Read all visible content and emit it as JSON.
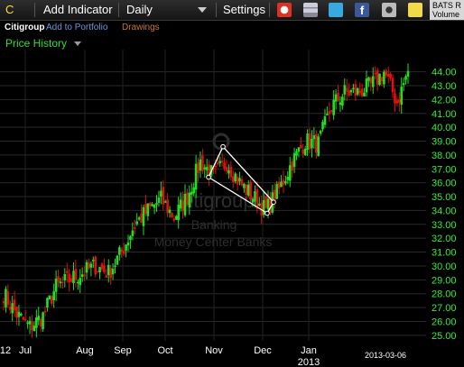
{
  "toolbar": {
    "symbol": "C",
    "add_indicator": "Add Indicator",
    "interval": "Daily",
    "settings": "Settings",
    "bats_label": "BATS R",
    "volume_label": "Volume"
  },
  "subnav": {
    "company": "Citigroup",
    "add_to_portfolio": "Add to Portfolio",
    "drawings": "Drawings"
  },
  "panel": {
    "title": "Price History"
  },
  "watermark": {
    "name": "citigroup",
    "sector": "Banking",
    "industry": "Money Center Banks"
  },
  "colors": {
    "up": "#22dd22",
    "down": "#dd1111",
    "ticks": "#33ee33",
    "drawings": "#cc7722",
    "link": "#6699dd"
  },
  "chart_data": {
    "type": "candlestick",
    "ylim": [
      24.6,
      45.6
    ],
    "y_ticks": [
      "44.00",
      "43.00",
      "42.00",
      "41.00",
      "40.00",
      "39.00",
      "38.00",
      "37.00",
      "36.00",
      "35.00",
      "34.00",
      "33.00",
      "32.00",
      "31.00",
      "30.00",
      "29.00",
      "28.00",
      "27.00",
      "26.00",
      "25.00"
    ],
    "x_ticks": [
      "12",
      "Jul",
      "Aug",
      "Sep",
      "Oct",
      "Nov",
      "Dec",
      "Jan",
      "2013",
      "2013-03-06"
    ],
    "grid": true,
    "trend": [
      [
        28.0,
        26.5
      ],
      [
        26.5,
        25.6
      ],
      [
        25.6,
        26.4
      ],
      [
        26.4,
        28.5
      ],
      [
        28.5,
        29.0
      ],
      [
        29.0,
        29.5
      ],
      [
        29.5,
        30.0
      ],
      [
        30.0,
        29.5
      ],
      [
        29.5,
        31.0
      ],
      [
        31.0,
        33.0
      ],
      [
        33.0,
        34.0
      ],
      [
        34.0,
        34.8
      ],
      [
        34.8,
        33.5
      ],
      [
        33.5,
        35.0
      ],
      [
        35.0,
        37.5
      ],
      [
        37.5,
        36.5
      ],
      [
        36.5,
        37.5
      ],
      [
        37.5,
        36.0
      ],
      [
        36.0,
        35.0
      ],
      [
        35.0,
        34.0
      ],
      [
        34.0,
        35.5
      ],
      [
        35.5,
        37.5
      ],
      [
        37.5,
        39.0
      ],
      [
        39.0,
        38.8
      ],
      [
        38.8,
        41.5
      ],
      [
        41.5,
        42.5
      ],
      [
        42.5,
        42.5
      ],
      [
        42.5,
        43.0
      ],
      [
        43.0,
        44.0
      ],
      [
        44.0,
        41.8
      ],
      [
        41.8,
        44.5
      ]
    ],
    "annotation_triangle": [
      [
        38.6,
        34.6
      ],
      [
        36.4,
        33.8
      ]
    ]
  }
}
